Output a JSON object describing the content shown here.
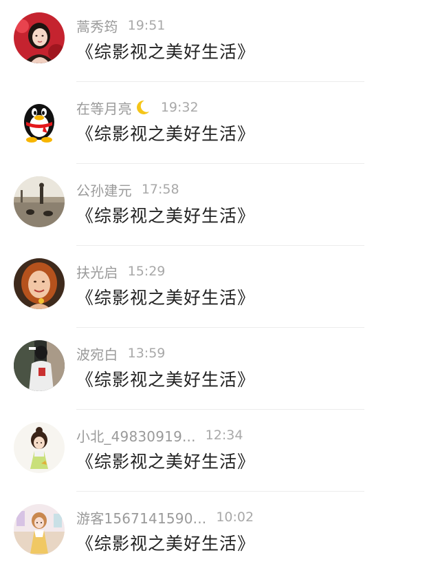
{
  "messages": [
    {
      "name": "蒿秀筠",
      "time": "19:51",
      "text": "《综影视之美好生活》",
      "avatar": "avatar-woman-red-background"
    },
    {
      "name": "在等月亮",
      "emoji": "crescent-moon-icon",
      "time": "19:32",
      "text": "《综影视之美好生活》",
      "avatar": "qq-penguin-icon"
    },
    {
      "name": "公孙建元",
      "time": "17:58",
      "text": "《综影视之美好生活》",
      "avatar": "avatar-street-with-dogs"
    },
    {
      "name": "扶光启",
      "time": "15:29",
      "text": "《综影视之美好生活》",
      "avatar": "avatar-red-haired-woman"
    },
    {
      "name": "波宛白",
      "time": "13:59",
      "text": "《综影视之美好生活》",
      "avatar": "avatar-person-white-jacket"
    },
    {
      "name": "小北_49830919...",
      "time": "12:34",
      "text": "《综影视之美好生活》",
      "avatar": "avatar-cartoon-girl"
    },
    {
      "name": "游客1567141590...",
      "time": "10:02",
      "text": "《综影视之美好生活》",
      "avatar": "avatar-illustrated-girl"
    }
  ],
  "colors": {
    "name": "#9a9a9a",
    "time": "#a8a8a8",
    "message": "#222222",
    "divider": "#ececec"
  }
}
